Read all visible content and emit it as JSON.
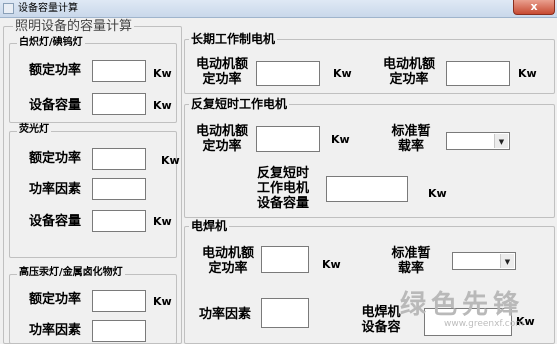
{
  "window": {
    "title": "设备容量计算",
    "close_label": "x"
  },
  "lighting": {
    "title": "照明设备的容量计算",
    "incandescent": {
      "title": "白炽灯/碘钨灯",
      "rated_power_label": "额定功率",
      "rated_power_value": "",
      "rated_power_unit": "Kw",
      "capacity_label": "设备容量",
      "capacity_value": "",
      "capacity_unit": "Kw"
    },
    "fluorescent": {
      "title": "荧光灯",
      "rated_power_label": "额定功率",
      "rated_power_value": "",
      "rated_power_unit": "Kw",
      "power_factor_label": "功率因素",
      "power_factor_value": "",
      "capacity_label": "设备容量",
      "capacity_value": "",
      "capacity_unit": "Kw"
    },
    "mercury": {
      "title": "高压汞灯/金属卤化物灯",
      "rated_power_label": "额定功率",
      "rated_power_value": "",
      "rated_power_unit": "Kw",
      "power_factor_label": "功率因素",
      "power_factor_value": ""
    }
  },
  "long_term_motor": {
    "title": "长期工作制电机",
    "motor_rated_power_label_1": "电动机额\n定功率",
    "motor_rated_power_value_1": "",
    "unit_1": "Kw",
    "motor_rated_power_label_2": "电动机额\n定功率",
    "motor_rated_power_value_2": "",
    "unit_2": "Kw"
  },
  "short_time_motor": {
    "title": "反复短时工作电机",
    "motor_rated_power_label": "电动机额\n定功率",
    "motor_rated_power_value": "",
    "motor_rated_power_unit": "Kw",
    "duty_rate_label": "标准暂\n载率",
    "duty_rate_value": "",
    "capacity_label": "反复短时\n工作电机\n设备容量",
    "capacity_value": "",
    "capacity_unit": "Kw"
  },
  "welder": {
    "title": "电焊机",
    "motor_rated_power_label": "电动机额\n定功率",
    "motor_rated_power_value": "",
    "motor_rated_power_unit": "Kw",
    "duty_rate_label": "标准暂\n载率",
    "duty_rate_value": "",
    "power_factor_label": "功率因素",
    "power_factor_value": "",
    "capacity_label": "电焊机\n设备容",
    "capacity_value": "",
    "capacity_unit": "Kw"
  },
  "watermark": {
    "text": "绿色先锋",
    "url": "www.greenxf.com"
  },
  "icons": {
    "app": "app-icon",
    "dropdown": "chevron-down-icon",
    "close": "close-icon"
  }
}
